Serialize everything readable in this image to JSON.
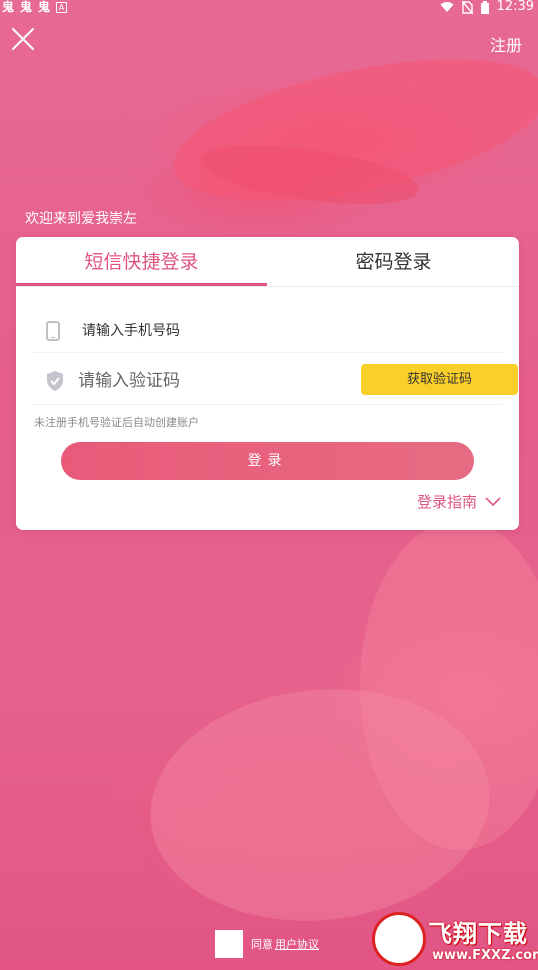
{
  "status_bar": {
    "left_icons": [
      "鬼",
      "鬼",
      "鬼",
      "A"
    ],
    "time": "12:39"
  },
  "header": {
    "register_label": "注册"
  },
  "welcome_text": "欢迎来到爱我崇左",
  "tabs": [
    {
      "label": "短信快捷登录"
    },
    {
      "label": "密码登录"
    }
  ],
  "form": {
    "phone_placeholder": "请输入手机号码",
    "code_placeholder": "请输入验证码",
    "get_code_label": "获取验证码",
    "hint": "未注册手机号验证后自动创建账户",
    "login_label": "登录",
    "guide_label": "登录指南"
  },
  "agreement": {
    "prefix": "同意",
    "link": "用户协议"
  },
  "watermark": {
    "title": "飞翔下载",
    "url": "www.FXXZ.com"
  },
  "colors": {
    "accent": "#e0567f",
    "button_yellow": "#fbcf2a",
    "background": "#e9668e"
  }
}
